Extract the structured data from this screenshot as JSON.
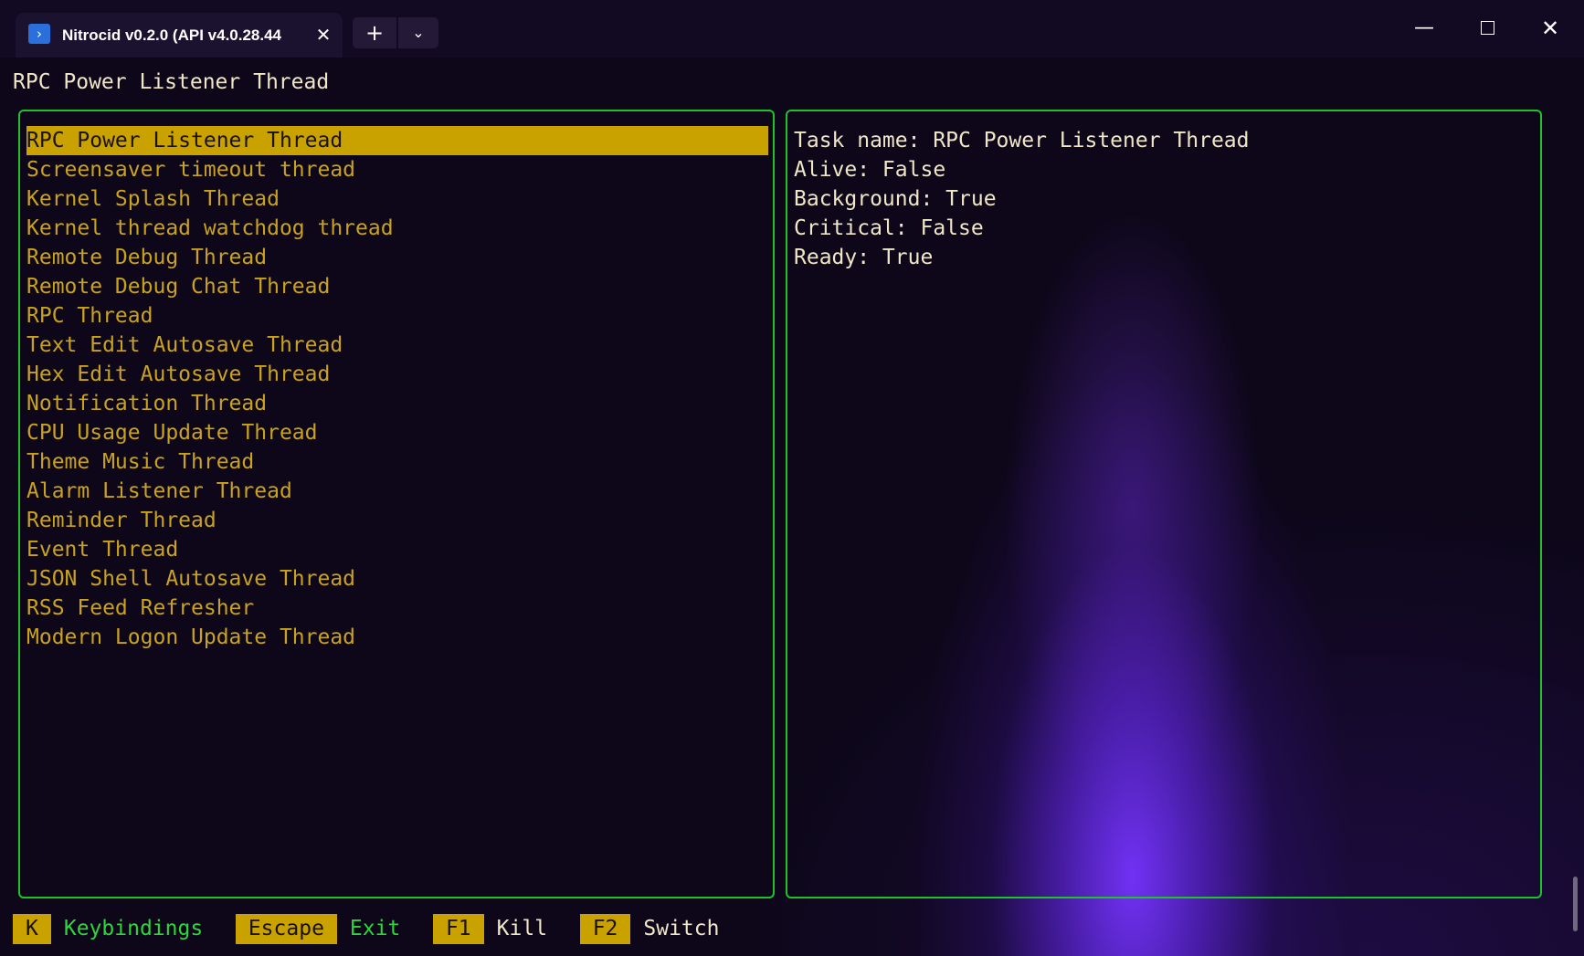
{
  "window": {
    "tab_title": "Nitrocid v0.2.0 (API v4.0.28.44",
    "tab_icon": "powershell-icon",
    "tab_close_glyph": "✕",
    "new_tab_glyph": "+",
    "dropdown_glyph": "⌄",
    "minimize_glyph": "—",
    "close_glyph": "✕"
  },
  "header": {
    "title": "RPC Power Listener Thread"
  },
  "threads": {
    "selected_index": 0,
    "items": [
      "RPC Power Listener Thread",
      "Screensaver timeout thread",
      "Kernel Splash Thread",
      "Kernel thread watchdog thread",
      "Remote Debug Thread",
      "Remote Debug Chat Thread",
      "RPC Thread",
      "Text Edit Autosave Thread",
      "Hex Edit Autosave Thread",
      "Notification Thread",
      "CPU Usage Update Thread",
      "Theme Music Thread",
      "Alarm Listener Thread",
      "Reminder Thread",
      "Event Thread",
      "JSON Shell Autosave Thread",
      "RSS Feed Refresher",
      "Modern Logon Update Thread"
    ]
  },
  "details": {
    "task_name": "Task name: RPC Power Listener Thread",
    "alive": "Alive: False",
    "background": "Background: True",
    "critical": "Critical: False",
    "ready": "Ready: True"
  },
  "keybindings": [
    {
      "key": "K",
      "label": "Keybindings"
    },
    {
      "key": "Escape",
      "label": "Exit"
    },
    {
      "key": "F1",
      "label": "Kill"
    },
    {
      "key": "F2",
      "label": "Switch"
    }
  ],
  "colors": {
    "border": "#1fc22b",
    "accent": "#c9a200",
    "list_text": "#c9a21e",
    "background": "#0d0719"
  }
}
